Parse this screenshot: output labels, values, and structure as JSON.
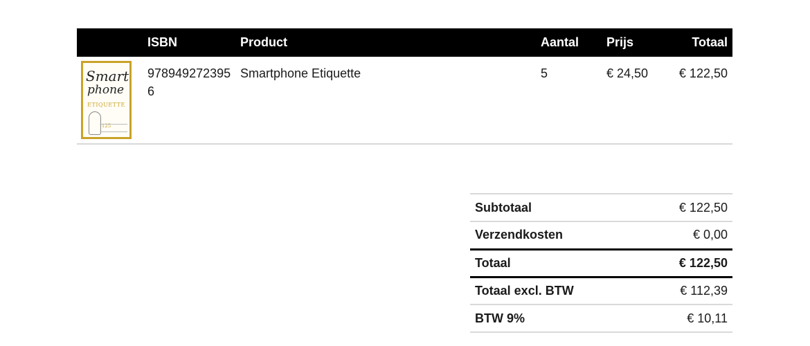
{
  "order_table": {
    "headers": {
      "image": "",
      "isbn": "ISBN",
      "product": "Product",
      "aantal": "Aantal",
      "prijs": "Prijs",
      "totaal": "Totaal"
    },
    "rows": [
      {
        "isbn": "9789492723956",
        "product": "Smartphone Etiquette",
        "aantal": "5",
        "prijs": "€ 24,50",
        "totaal": "€ 122,50",
        "cover": {
          "title_line1": "Smart",
          "title_line2": "phone",
          "title_line3": "ETIQUETTE",
          "number": "125"
        }
      }
    ]
  },
  "totals": {
    "subtotaal_label": "Subtotaal",
    "subtotaal_value": "€ 122,50",
    "verzendkosten_label": "Verzendkosten",
    "verzendkosten_value": "€ 0,00",
    "totaal_label": "Totaal",
    "totaal_value": "€ 122,50",
    "excl_label": "Totaal excl. BTW",
    "excl_value": "€ 112,39",
    "btw_label": "BTW 9%",
    "btw_value": "€ 10,11"
  },
  "colors": {
    "header_background": "#000000",
    "header_text": "#ffffff",
    "divider": "#d9d9d9",
    "cover_accent": "#c9a227"
  }
}
